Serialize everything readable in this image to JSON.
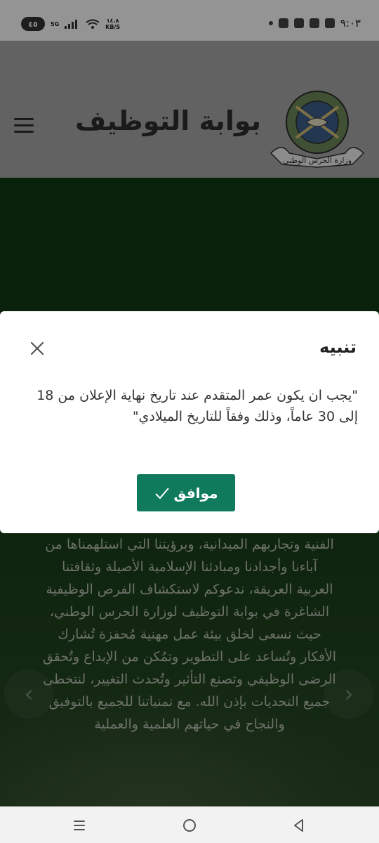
{
  "status_bar": {
    "battery": "٤٥",
    "network": "5G",
    "speed_value": "١٤.٨",
    "speed_unit": "KB/S",
    "time": "٩:٠٣"
  },
  "header": {
    "title": "بوابة التوظيف",
    "logo_text": "وزارة الحرس الوطني"
  },
  "hero": {
    "paragraph": "الفنية وتجاربهم الميدانية، وبرؤيتنا التي استلهمناها من آباءنا وأجدادنا ومبادئنا الإسلامية الأصيلة وثقافتنا العربية العريقة، ندعوكم لاستكشاف الفرص الوظيفية الشاغرة في بوابة التوظيف لوزارة الحرس الوطني، حيث نسعى لخلق بيئة عمل مهنية مُحفزة تُشارك الأفكار وتُساعد على التطوير وتمُكن من الإبداع وتُحقق الرضى الوظيفي وتصنع التأثير وتُحدث التغيير، لنتخطى جميع التحديات بإذن الله. مع تمنياتنا للجميع بالتوفيق والنجاح في حياتهم العلمية والعملية"
  },
  "modal": {
    "title": "تنبيه",
    "message": "\"يجب ان يكون عمر المتقدم عند تاريخ نهاية الإعلان من 18 إلى 30 عاماً، وذلك وفقاً للتاريخ الميلادي\"",
    "ok_label": "موافق"
  },
  "colors": {
    "header_bg": "#a9a9a9",
    "hero_bg": "#153d16",
    "ok_button": "#0f7a5c"
  }
}
